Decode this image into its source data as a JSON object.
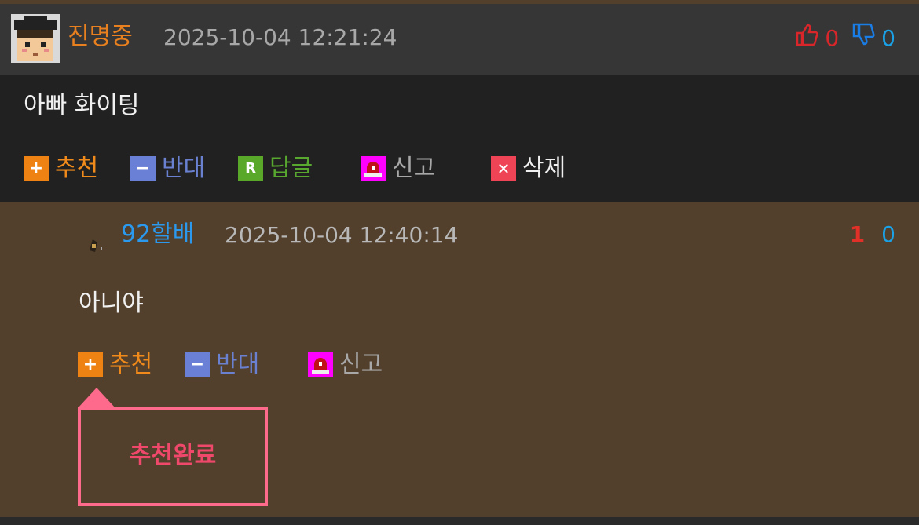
{
  "comment": {
    "author": "진명중",
    "timestamp": "2025-10-04 12:21:24",
    "upvotes": "0",
    "downvotes": "0",
    "text": "아빠 화이팅",
    "actions": {
      "recommend": "추천",
      "oppose": "반대",
      "reply": "답글",
      "report": "신고",
      "delete": "삭제"
    }
  },
  "reply": {
    "author": "92할배",
    "timestamp": "2025-10-04 12:40:14",
    "upvotes": "1",
    "downvotes": "0",
    "text": "아니야",
    "actions": {
      "recommend": "추천",
      "oppose": "반대",
      "report": "신고"
    },
    "popup_text": "추천완료"
  },
  "colors": {
    "author": "#e8801f",
    "reply_author": "#2a99ee",
    "upvote": "#d8262a",
    "downvote": "#1aa1e6",
    "popup_border": "#fd6a8c"
  },
  "icons": {
    "avatar": "pixel-avatar-icon",
    "thumbs_up": "thumbs-up-icon",
    "thumbs_down": "thumbs-down-icon",
    "plus": "plus-icon",
    "minus": "minus-icon",
    "reply": "reply-r-icon",
    "report": "siren-icon",
    "delete": "close-x-icon"
  }
}
